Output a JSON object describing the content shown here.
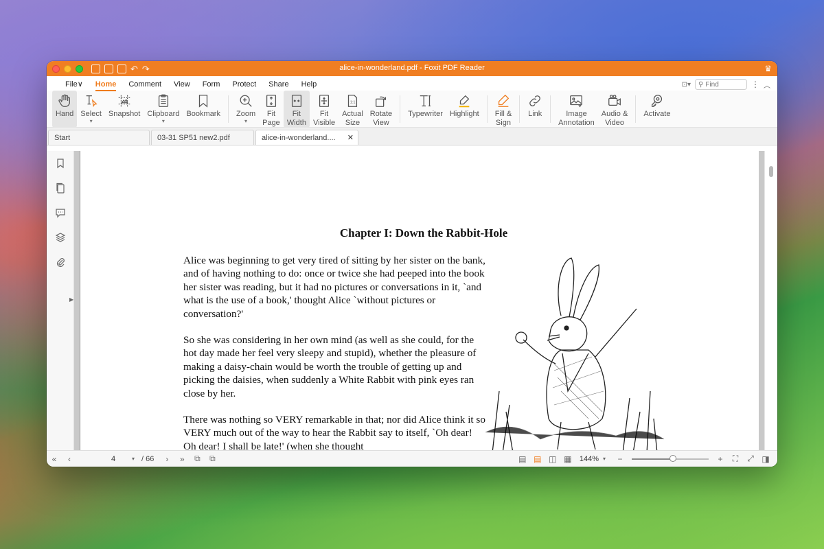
{
  "window": {
    "title": "alice-in-wonderland.pdf - Foxit PDF Reader",
    "accent": "#f07e22"
  },
  "menu": {
    "items": [
      {
        "label": "File∨",
        "name": "menu-file"
      },
      {
        "label": "Home",
        "name": "menu-home",
        "active": true
      },
      {
        "label": "Comment",
        "name": "menu-comment"
      },
      {
        "label": "View",
        "name": "menu-view"
      },
      {
        "label": "Form",
        "name": "menu-form"
      },
      {
        "label": "Protect",
        "name": "menu-protect"
      },
      {
        "label": "Share",
        "name": "menu-share"
      },
      {
        "label": "Help",
        "name": "menu-help"
      }
    ],
    "find_placeholder": "Find"
  },
  "toolbar": {
    "hand": "Hand",
    "select": "Select",
    "snapshot": "Snapshot",
    "clipboard": "Clipboard",
    "bookmark": "Bookmark",
    "zoom": "Zoom",
    "fit_page_1": "Fit",
    "fit_page_2": "Page",
    "fit_width_1": "Fit",
    "fit_width_2": "Width",
    "fit_visible_1": "Fit",
    "fit_visible_2": "Visible",
    "actual_size_1": "Actual",
    "actual_size_2": "Size",
    "rotate_view_1": "Rotate",
    "rotate_view_2": "View",
    "typewriter": "Typewriter",
    "highlight": "Highlight",
    "fill_sign_1": "Fill &",
    "fill_sign_2": "Sign",
    "link": "Link",
    "image_annotation_1": "Image",
    "image_annotation_2": "Annotation",
    "audio_video_1": "Audio &",
    "audio_video_2": "Video",
    "activate": "Activate"
  },
  "tabs": [
    {
      "label": "Start"
    },
    {
      "label": "03-31 SP51 new2.pdf"
    },
    {
      "label": "alice-in-wonderland....",
      "active": true
    }
  ],
  "document": {
    "chapter_title": "Chapter I: Down the Rabbit-Hole",
    "paragraphs": [
      "Alice was beginning to get very tired of sitting by her sister on the bank, and of having nothing to do: once or twice she had peeped into the book her sister was reading, but it had no pictures or conversations in it, `and what is the use of a book,' thought Alice `without pictures or conversation?'",
      "So she was considering in her own mind (as well as she could, for the hot day made her feel very sleepy and stupid), whether the pleasure of making a daisy-chain would be worth the trouble of getting up and picking the daisies, when suddenly a White Rabbit with pink eyes ran close by her.",
      "There was nothing so VERY remarkable in that; nor did Alice think it so VERY much out of the way to hear the Rabbit say to itself, `Oh dear! Oh dear! I shall be late!' (when she thought"
    ]
  },
  "status": {
    "current_page": "4",
    "total_pages": "/ 66",
    "zoom": "144%",
    "zoom_slider_fraction": 0.54
  }
}
